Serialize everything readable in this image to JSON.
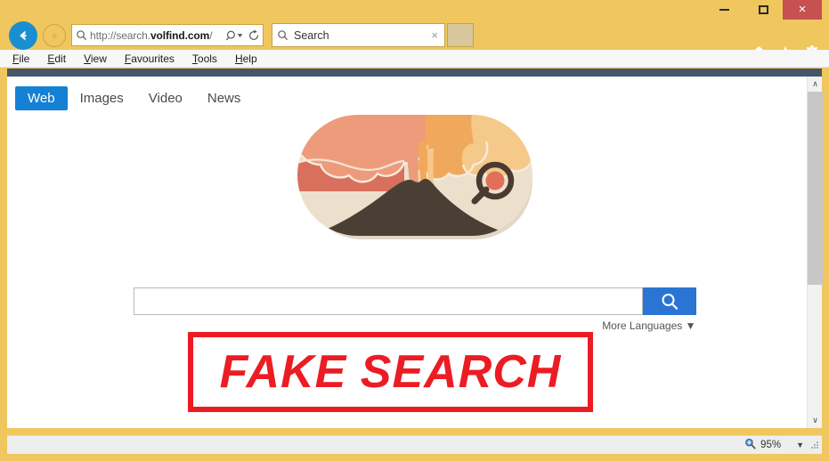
{
  "window": {
    "controls": {
      "minimize": "minimize-button",
      "maximize": "maximize-button",
      "close_label": "×"
    },
    "accent_titlebar_color": "#f0c75e",
    "close_button_color": "#c75050"
  },
  "navigation": {
    "back_label": "←",
    "forward_label": "→",
    "address": {
      "url_prefix": "http://search.",
      "url_domain": "volfind.com",
      "url_suffix": "/",
      "full_url": "http://search.volfind.com/"
    },
    "search_tab": {
      "label": "Search",
      "close_label": "×"
    },
    "command_icons": [
      "home-icon",
      "favorites-star-icon",
      "settings-gear-icon"
    ]
  },
  "menubar": {
    "items": [
      {
        "accesskey": "F",
        "rest": "ile"
      },
      {
        "accesskey": "E",
        "rest": "dit"
      },
      {
        "accesskey": "V",
        "rest": "iew"
      },
      {
        "accesskey": "F",
        "rest": "avourites"
      },
      {
        "accesskey": "T",
        "rest": "ools"
      },
      {
        "accesskey": "H",
        "rest": "elp"
      }
    ]
  },
  "page": {
    "header_bar_color": "#46566b",
    "tabs": [
      {
        "label": "Web",
        "active": true
      },
      {
        "label": "Images",
        "active": false
      },
      {
        "label": "Video",
        "active": false
      },
      {
        "label": "News",
        "active": false
      }
    ],
    "active_tab_color": "#1581d4",
    "logo": {
      "name": "volcano-search-logo",
      "pill_background": "#ece0cd",
      "volcano_color": "#4a3f35",
      "smoke_colors": [
        "#d9705e",
        "#ed9b7b",
        "#f0a95c",
        "#f5c98a"
      ],
      "magnifier_ring_color": "#4a3a31",
      "magnifier_lens_color": "#e0705a"
    },
    "search": {
      "value": "",
      "placeholder": "",
      "button_icon": "search-icon",
      "button_color": "#2a75d4"
    },
    "more_languages": {
      "label": "More Languages",
      "caret": "▼"
    },
    "overlay_stamp": {
      "text": "FAKE SEARCH",
      "color": "#ec1c24"
    }
  },
  "statusbar": {
    "zoom": {
      "icon": "zoom-magnifier-icon",
      "level": "95%",
      "caret": "▼"
    }
  },
  "scrollbar": {
    "up_arrow": "∧",
    "down_arrow": "∨"
  }
}
